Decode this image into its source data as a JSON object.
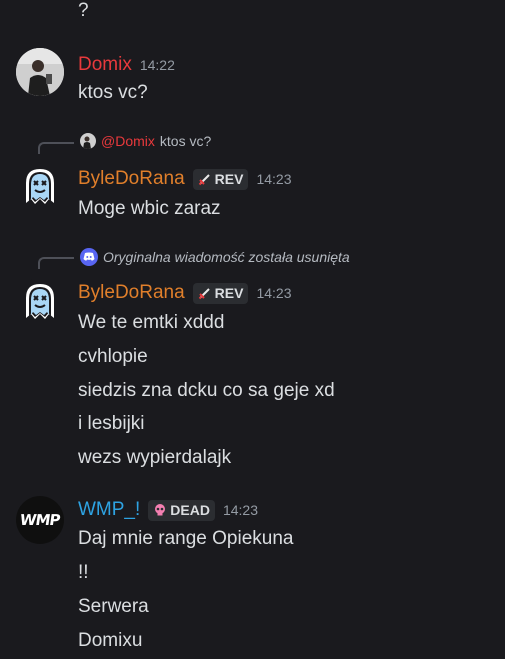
{
  "top_fragment": {
    "text": "?"
  },
  "messages": [
    {
      "username": "Domix",
      "username_color": "#e8393c",
      "time": "14:22",
      "avatar": "photo-avatar",
      "lines": [
        "ktos vc?"
      ]
    },
    {
      "reply": {
        "mention": "@Domix",
        "text": "ktos vc?"
      },
      "username": "ByleDoRana",
      "username_color": "#e07f2b",
      "badge": {
        "icon": "sword-icon",
        "label": "REV"
      },
      "time": "14:23",
      "avatar": "ghost-avatar",
      "lines": [
        "Moge wbic zaraz"
      ]
    },
    {
      "reply": {
        "deleted_text": "Oryginalna wiadomość została usunięta"
      },
      "username": "ByleDoRana",
      "username_color": "#e07f2b",
      "badge": {
        "icon": "sword-icon",
        "label": "REV"
      },
      "time": "14:23",
      "avatar": "ghost-avatar",
      "lines": [
        "We te emtki xddd",
        "cvhlopie",
        "siedzis zna dcku co sa geje xd",
        "i lesbijki",
        "wezs wypierdalajk"
      ]
    },
    {
      "username": "WMP_!",
      "username_color": "#2ea3e3",
      "badge": {
        "icon": "skull-icon",
        "label": "DEAD"
      },
      "time": "14:23",
      "avatar": "wmp-logo-avatar",
      "avatar_text": "WMP",
      "lines": [
        "Daj mnie range Opiekuna",
        "!!",
        "Serwera",
        "Domixu"
      ]
    }
  ]
}
